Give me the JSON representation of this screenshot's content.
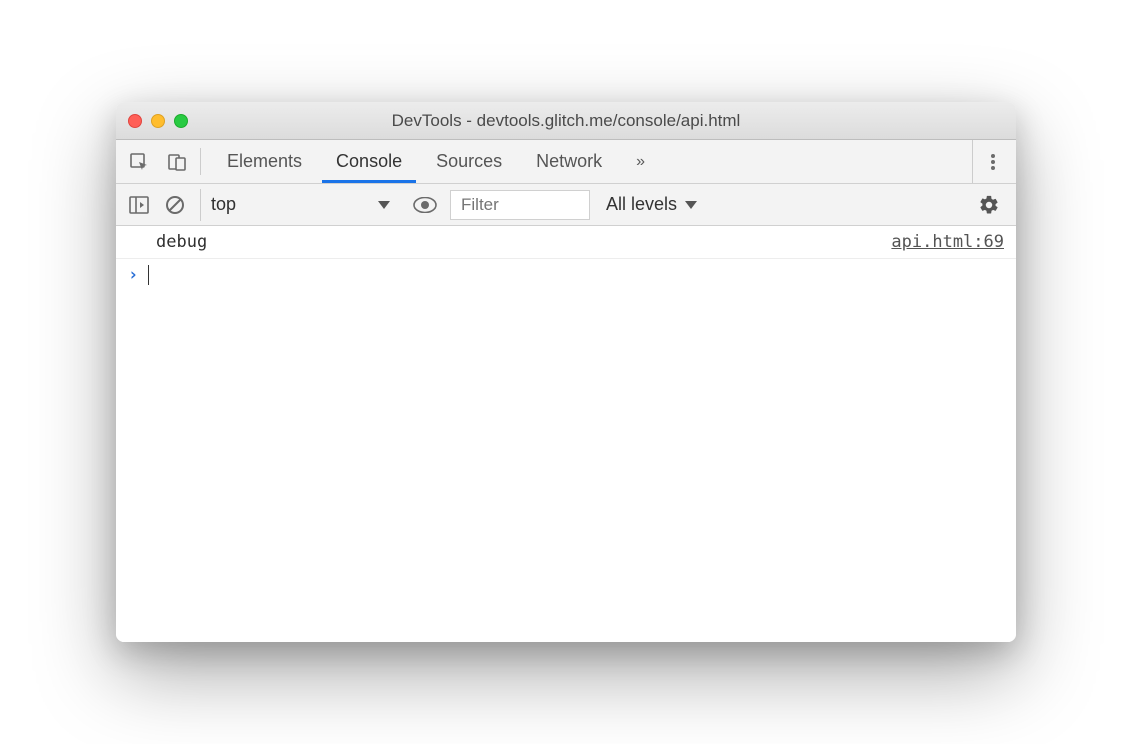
{
  "window": {
    "title": "DevTools - devtools.glitch.me/console/api.html"
  },
  "tabs": {
    "items": [
      {
        "label": "Elements",
        "active": false
      },
      {
        "label": "Console",
        "active": true
      },
      {
        "label": "Sources",
        "active": false
      },
      {
        "label": "Network",
        "active": false
      }
    ],
    "more": "»"
  },
  "toolbar": {
    "context": "top",
    "filter_placeholder": "Filter",
    "levels_label": "All levels"
  },
  "console": {
    "log_message": "debug",
    "log_source": "api.html:69",
    "prompt": "›"
  }
}
